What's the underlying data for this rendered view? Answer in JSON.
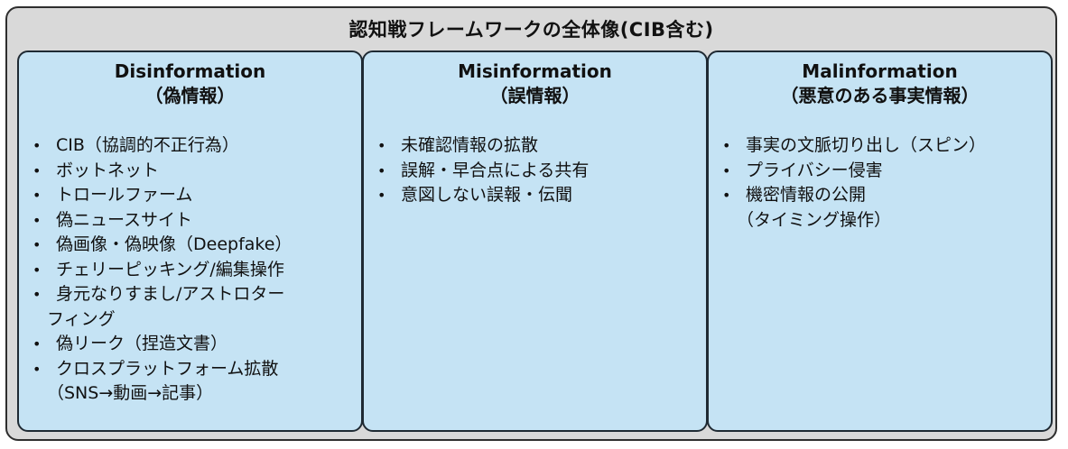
{
  "title": "認知戦フレームワークの全体像(CIB含む)",
  "panels": [
    {
      "heading": "Disinformation",
      "subheading": "（偽情報）",
      "items": [
        {
          "text": "CIB（協調的不正行為）",
          "cont": ""
        },
        {
          "text": "ボットネット",
          "cont": ""
        },
        {
          "text": "トロールファーム",
          "cont": ""
        },
        {
          "text": "偽ニュースサイト",
          "cont": ""
        },
        {
          "text": "偽画像・偽映像（Deepfake）",
          "cont": ""
        },
        {
          "text": "チェリーピッキング/編集操作",
          "cont": ""
        },
        {
          "text": "身元なりすまし/アストロター",
          "cont": "フィング"
        },
        {
          "text": "偽リーク（捏造文書）",
          "cont": ""
        },
        {
          "text": "クロスプラットフォーム拡散",
          "cont": "（SNS→動画→記事）"
        }
      ]
    },
    {
      "heading": "Misinformation",
      "subheading": "（誤情報）",
      "items": [
        {
          "text": "未確認情報の拡散",
          "cont": ""
        },
        {
          "text": "誤解・早合点による共有",
          "cont": ""
        },
        {
          "text": "意図しない誤報・伝聞",
          "cont": ""
        }
      ]
    },
    {
      "heading": "Malinformation",
      "subheading": "（悪意のある事実情報）",
      "items": [
        {
          "text": "事実の文脈切り出し（スピン）",
          "cont": ""
        },
        {
          "text": "プライバシー侵害",
          "cont": ""
        },
        {
          "text": "機密情報の公開",
          "cont": "（タイミング操作）"
        }
      ]
    }
  ]
}
